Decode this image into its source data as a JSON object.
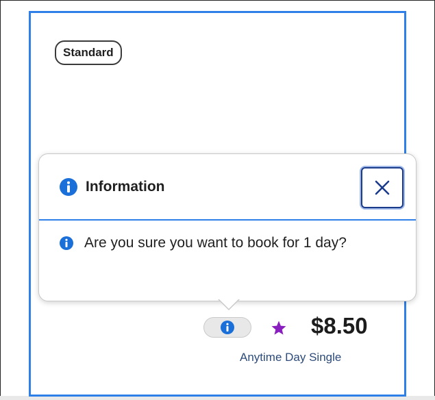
{
  "card": {
    "tag_label": "Standard",
    "price": "$8.50",
    "fare_name": "Anytime Day Single"
  },
  "popover": {
    "title": "Information",
    "message": "Are you sure you want to book for 1 day?",
    "close_icon": "close-icon"
  },
  "icons": {
    "header": "info-icon",
    "body": "info-icon",
    "pill": "info-icon",
    "favorite": "star-icon"
  },
  "colors": {
    "accent_blue": "#2f7fe8",
    "info_blue": "#1a6fd8",
    "close_border": "#1a3a8a",
    "star_purple": "#8a1fbf",
    "fare_text": "#2c4a7a"
  }
}
